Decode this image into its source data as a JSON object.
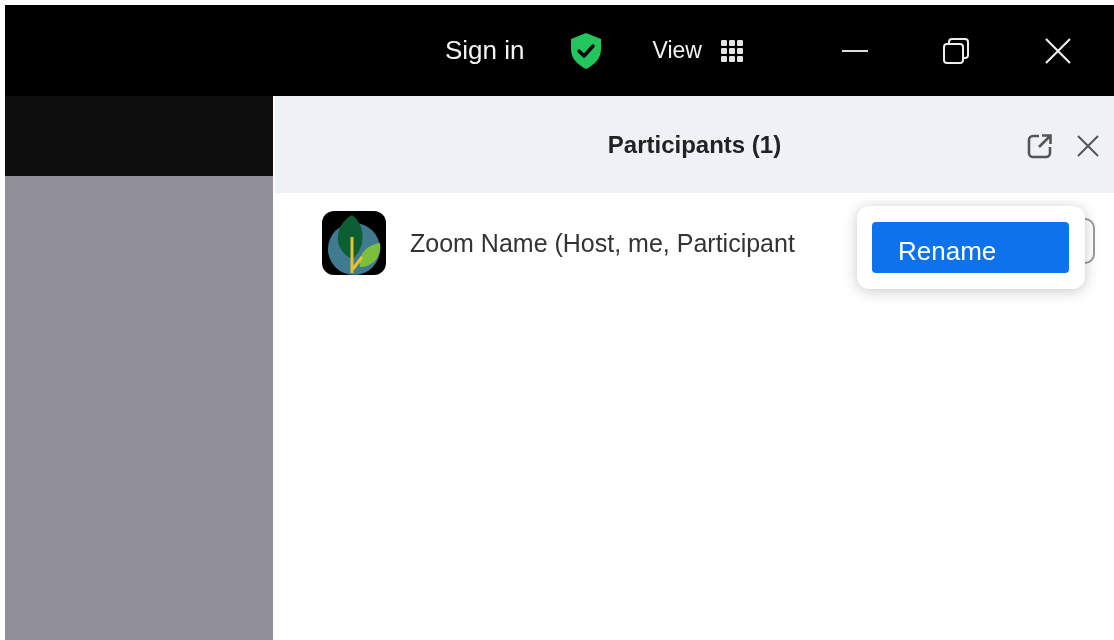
{
  "title_bar": {
    "sign_in": "Sign in",
    "view": "View"
  },
  "panel": {
    "title": "Participants (1)"
  },
  "participants": [
    {
      "name": "Zoom Name (Host, me, Participant"
    }
  ],
  "context_menu": {
    "items": [
      {
        "label": "Rename",
        "selected": true
      }
    ]
  }
}
